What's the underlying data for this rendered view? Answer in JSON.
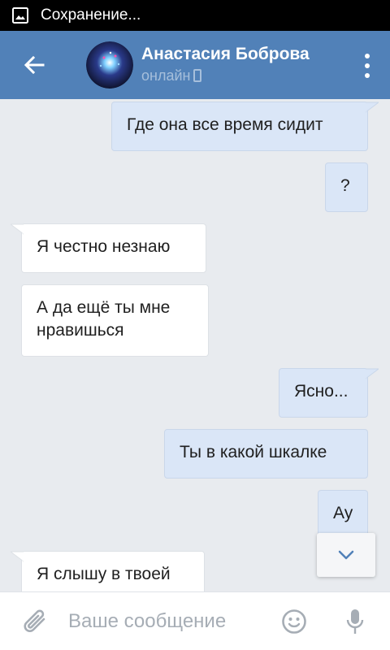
{
  "status_bar": {
    "text": "Сохранение...",
    "icon": "image-icon"
  },
  "header": {
    "name": "Анастасия Боброва",
    "status": "онлайн",
    "status_icon": "phone-icon",
    "colors": {
      "bar": "#5181b8",
      "status_text": "#a6bfdb"
    }
  },
  "messages": [
    {
      "direction": "out",
      "text": "Где она все время сидит"
    },
    {
      "direction": "out",
      "text": "?"
    },
    {
      "direction": "in",
      "text": "Я честно незнаю"
    },
    {
      "direction": "in",
      "text": "А да ещё ты мне нравишься"
    },
    {
      "direction": "out",
      "text": "Ясно..."
    },
    {
      "direction": "out",
      "text": "Ты в какой шкалке"
    },
    {
      "direction": "out",
      "text": "Ау"
    },
    {
      "direction": "in",
      "text": "Я слышу в твоей"
    }
  ],
  "composer": {
    "placeholder": "Ваше сообщение",
    "attach_icon": "paperclip-icon",
    "emoji_icon": "smiley-icon",
    "mic_icon": "microphone-icon"
  },
  "colors": {
    "background": "#e8ebef",
    "outgoing_bubble": "#dae6f7",
    "incoming_bubble": "#ffffff"
  }
}
